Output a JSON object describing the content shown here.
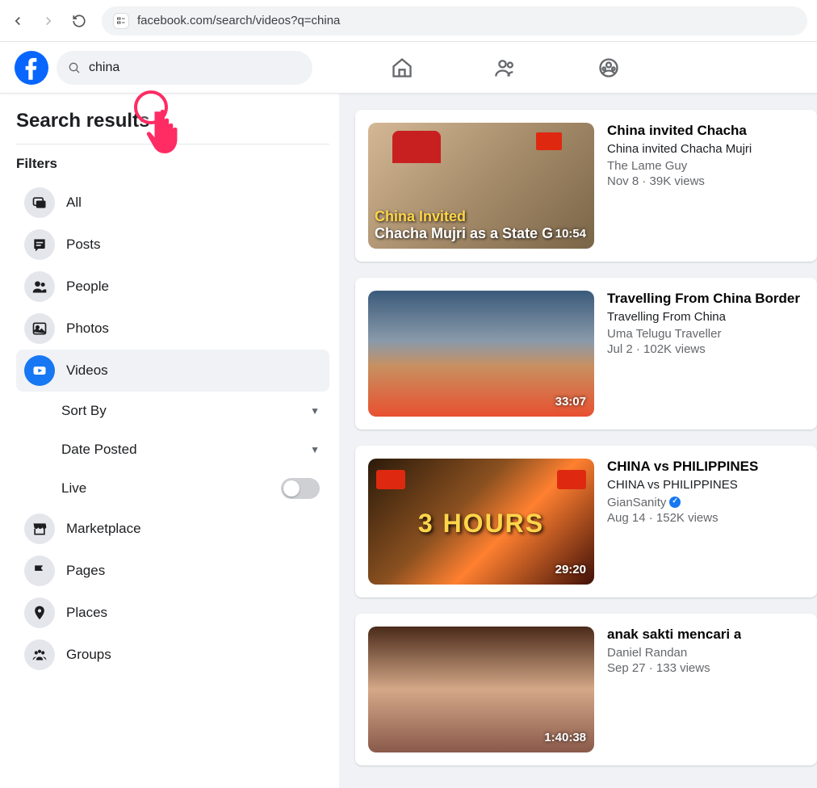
{
  "browser": {
    "url": "facebook.com/search/videos?q=china"
  },
  "search": {
    "value": "china"
  },
  "sidebar": {
    "title": "Search results",
    "filters_heading": "Filters",
    "items": [
      {
        "label": "All"
      },
      {
        "label": "Posts"
      },
      {
        "label": "People"
      },
      {
        "label": "Photos"
      },
      {
        "label": "Videos"
      },
      {
        "label": "Marketplace"
      },
      {
        "label": "Pages"
      },
      {
        "label": "Places"
      },
      {
        "label": "Groups"
      }
    ],
    "sort_by": "Sort By",
    "date_posted": "Date Posted",
    "live": "Live"
  },
  "results": [
    {
      "title": "China invited Chacha",
      "subtitle": "China invited Chacha Mujri",
      "author": "The Lame Guy",
      "date": "Nov 8",
      "views": "39K views",
      "duration": "10:54",
      "overlay1": "China Invited",
      "overlay2": "Chacha Mujri as a State G",
      "verified": false
    },
    {
      "title": "Travelling From China Border",
      "subtitle": "Travelling From China",
      "author": "Uma Telugu Traveller",
      "date": "Jul 2",
      "views": "102K views",
      "duration": "33:07",
      "verified": false
    },
    {
      "title": "CHINA vs PHILIPPINES",
      "subtitle": "CHINA vs PHILIPPINES",
      "author": "GianSanity",
      "date": "Aug 14",
      "views": "152K views",
      "duration": "29:20",
      "center_text": "3 HOURS",
      "verified": true
    },
    {
      "title": "anak sakti mencari a",
      "subtitle": "",
      "author": "Daniel Randan",
      "date": "Sep 27",
      "views": "133 views",
      "duration": "1:40:38",
      "verified": false
    }
  ]
}
